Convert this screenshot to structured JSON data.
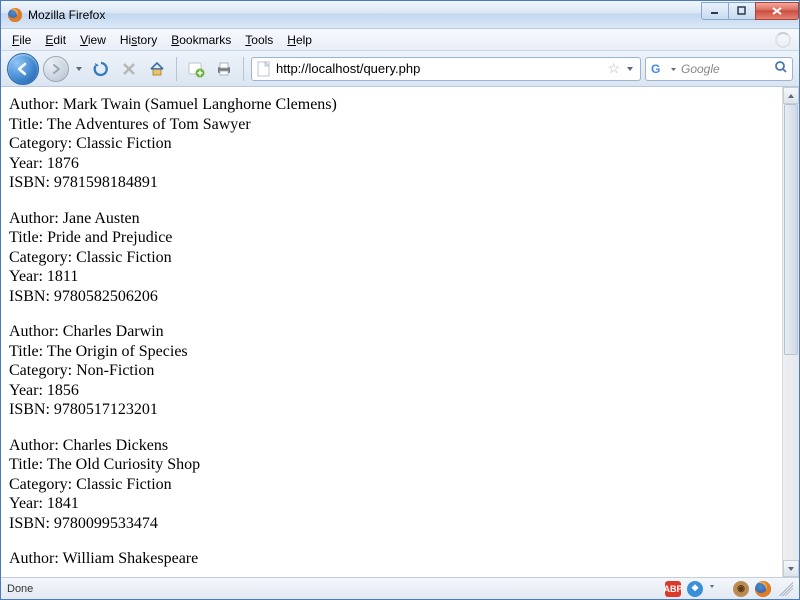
{
  "window": {
    "title": "Mozilla Firefox"
  },
  "menu": {
    "file": "File",
    "edit": "Edit",
    "view": "View",
    "history": "History",
    "bookmarks": "Bookmarks",
    "tools": "Tools",
    "help": "Help"
  },
  "urlbar": {
    "value": "http://localhost/query.php"
  },
  "searchbar": {
    "placeholder": "Google"
  },
  "status": {
    "text": "Done"
  },
  "records": [
    {
      "author": "Mark Twain (Samuel Langhorne Clemens)",
      "title": "The Adventures of Tom Sawyer",
      "category": "Classic Fiction",
      "year": "1876",
      "isbn": "9781598184891"
    },
    {
      "author": "Jane Austen",
      "title": "Pride and Prejudice",
      "category": "Classic Fiction",
      "year": "1811",
      "isbn": "9780582506206"
    },
    {
      "author": "Charles Darwin",
      "title": "The Origin of Species",
      "category": "Non-Fiction",
      "year": "1856",
      "isbn": "9780517123201"
    },
    {
      "author": "Charles Dickens",
      "title": "The Old Curiosity Shop",
      "category": "Classic Fiction",
      "year": "1841",
      "isbn": "9780099533474"
    },
    {
      "author": "William Shakespeare",
      "title": "",
      "category": "",
      "year": "",
      "isbn": ""
    }
  ],
  "labels": {
    "author": "Author",
    "title": "Title",
    "category": "Category",
    "year": "Year",
    "isbn": "ISBN"
  }
}
